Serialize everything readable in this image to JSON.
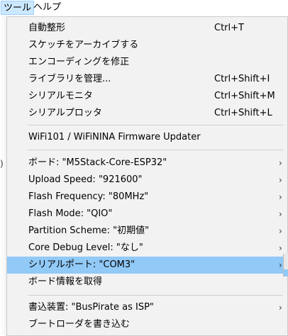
{
  "menubar": {
    "tools_label": "ツール",
    "help_label": "ヘルプ"
  },
  "left_fragment": ")",
  "menu": {
    "items": [
      {
        "label": "自動整形",
        "shortcut": "Ctrl+T"
      },
      {
        "label": "スケッチをアーカイブする",
        "shortcut": ""
      },
      {
        "label": "エンコーディングを修正",
        "shortcut": ""
      },
      {
        "label": "ライブラリを管理...",
        "shortcut": "Ctrl+Shift+I"
      },
      {
        "label": "シリアルモニタ",
        "shortcut": "Ctrl+Shift+M"
      },
      {
        "label": "シリアルプロッタ",
        "shortcut": "Ctrl+Shift+L"
      },
      {
        "label": "WiFi101 / WiFiNINA Firmware Updater",
        "shortcut": ""
      },
      {
        "label": "ボード: \"M5Stack-Core-ESP32\"",
        "submenu": true
      },
      {
        "label": "Upload Speed: \"921600\"",
        "submenu": true
      },
      {
        "label": "Flash Frequency: \"80MHz\"",
        "submenu": true
      },
      {
        "label": "Flash Mode: \"QIO\"",
        "submenu": true
      },
      {
        "label": "Partition Scheme: \"初期値\"",
        "submenu": true
      },
      {
        "label": "Core Debug Level: \"なし\"",
        "submenu": true
      },
      {
        "label": "シリアルポート: \"COM3\"",
        "submenu": true,
        "highlighted": true
      },
      {
        "label": "ボード情報を取得",
        "shortcut": ""
      },
      {
        "label": "書込装置: \"BusPirate as ISP\"",
        "submenu": true
      },
      {
        "label": "ブートローダを書き込む",
        "shortcut": ""
      }
    ],
    "arrow_glyph": "›"
  }
}
